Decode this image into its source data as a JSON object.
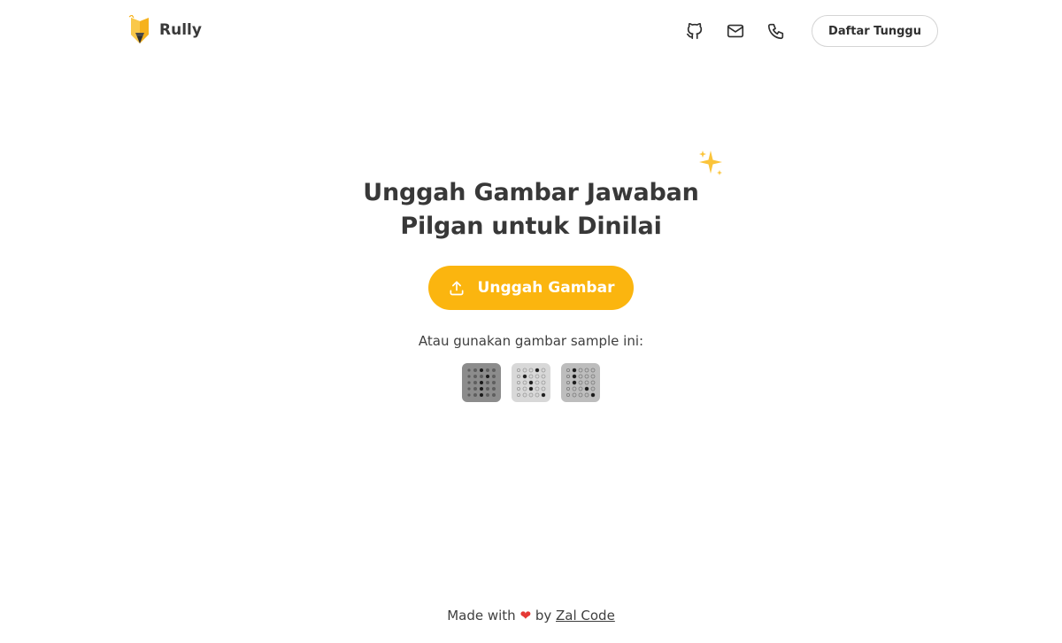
{
  "header": {
    "brand": "Rully",
    "nav_icons": [
      "github-icon",
      "mail-icon",
      "phone-icon"
    ],
    "waitlist_label": "Daftar Tunggu"
  },
  "hero": {
    "title_line1": "Unggah Gambar Jawaban",
    "title_line2": "Pilgan untuk Dinilai",
    "upload_label": "Unggah Gambar",
    "sample_label": "Atau gunakan gambar sample ini:",
    "samples": [
      "sample-1",
      "sample-2",
      "sample-3"
    ]
  },
  "footer": {
    "prefix": "Made with",
    "heart": "❤",
    "by": "by",
    "author": "Zal Code"
  },
  "colors": {
    "accent": "#fbb50f",
    "text": "#383838",
    "heart": "#e53935"
  }
}
